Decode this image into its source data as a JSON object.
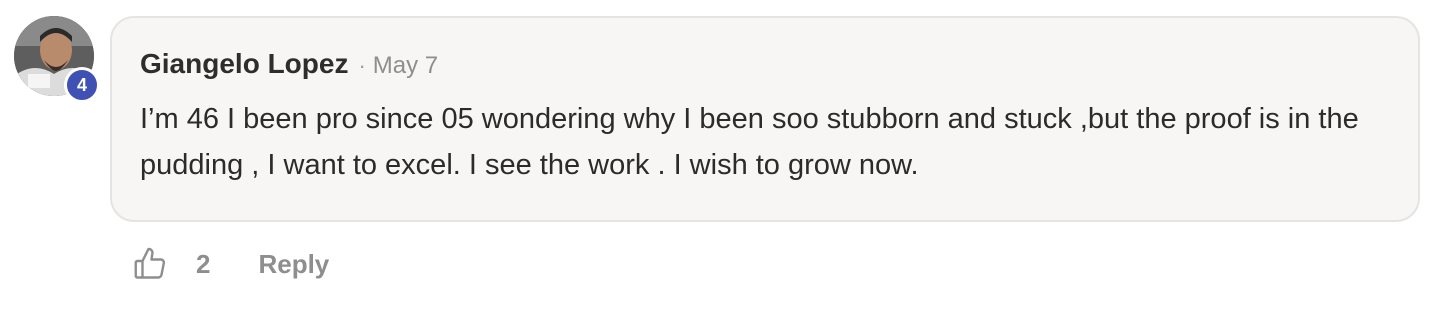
{
  "comment": {
    "author": "Giangelo Lopez",
    "separator": "·",
    "date": "May 7",
    "text": "I’m 46 I been pro since 05 wondering why I been soo stubborn and stuck ,but the proof is in the pudding , I want to excel. I see the work . I wish to grow now.",
    "level": "4",
    "like_count": "2",
    "reply_label": "Reply",
    "colors": {
      "bubble_bg": "#f7f6f4",
      "badge": "#3f51b5",
      "muted_text": "#8e8e8e"
    },
    "icons": {
      "like": "thumbs-up-icon"
    }
  }
}
